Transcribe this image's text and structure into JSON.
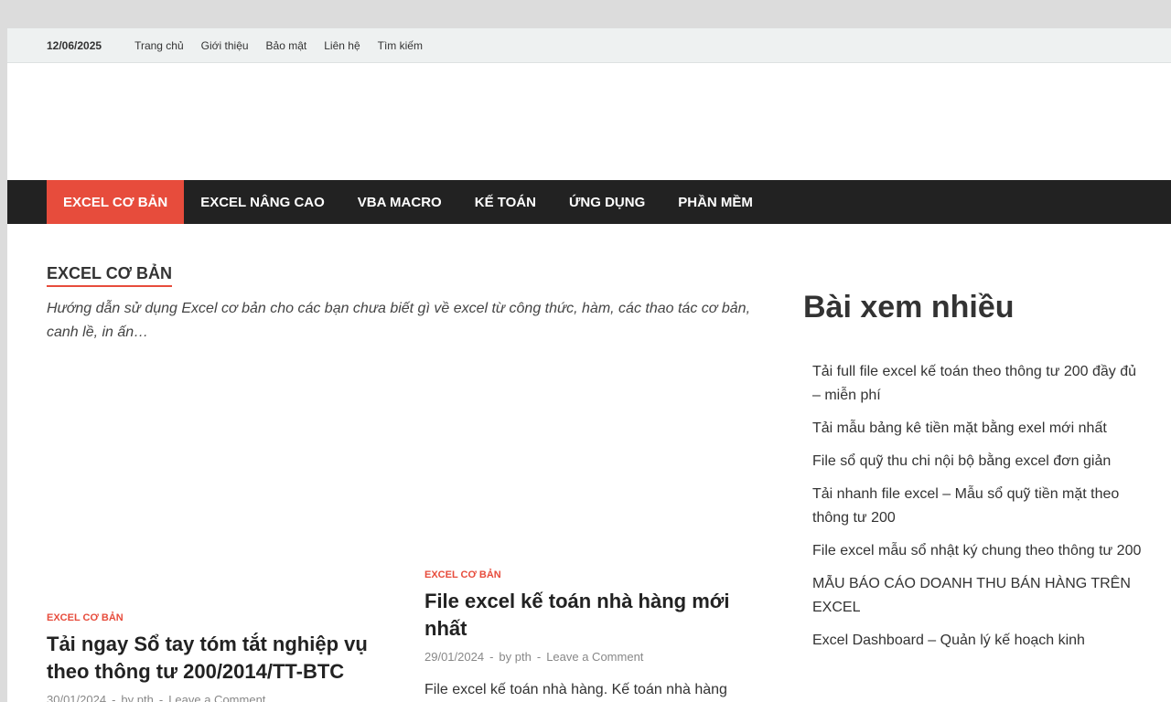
{
  "topbar": {
    "date": "12/06/2025",
    "links": [
      "Trang chủ",
      "Giới thiệu",
      "Bảo mật",
      "Liên hệ",
      "Tìm kiếm"
    ]
  },
  "nav": {
    "items": [
      "EXCEL CƠ BẢN",
      "EXCEL NÂNG CAO",
      "VBA MACRO",
      "KẾ TOÁN",
      "ỨNG DỤNG",
      "PHẦN MỀM"
    ]
  },
  "archive": {
    "title": "EXCEL CƠ BẢN",
    "description": "Hướng dẫn sử dụng Excel cơ bản cho các bạn chưa biết gì về excel từ công thức, hàm, các thao tác cơ bản, canh lề, in ấn…"
  },
  "posts": [
    {
      "category": "EXCEL CƠ BẢN",
      "title": "Tải ngay Sổ tay tóm tắt nghiệp vụ theo thông tư 200/2014/TT-BTC",
      "date": "30/01/2024",
      "author": "by pth",
      "comment": "Leave a Comment"
    },
    {
      "category": "EXCEL CƠ BẢN",
      "title": "File excel kế toán nhà hàng mới nhất",
      "date": "29/01/2024",
      "author": "by pth",
      "comment": "Leave a Comment",
      "excerpt": "File excel kế toán nhà hàng. Kế toán nhà hàng"
    }
  ],
  "meta_separator": "-",
  "sidebar": {
    "title": "Bài xem nhiều",
    "items": [
      "Tải full file excel kế toán theo thông tư 200 đầy đủ – miễn phí",
      "Tải mẫu bảng kê tiền mặt bằng exel mới nhất",
      "File sổ quỹ thu chi nội bộ bằng excel đơn giản",
      "Tải nhanh file excel – Mẫu sổ quỹ tiền mặt theo thông tư 200",
      "File excel mẫu sổ nhật ký chung theo thông tư 200",
      "MẪU BÁO CÁO DOANH THU BÁN HÀNG TRÊN EXCEL",
      "Excel Dashboard – Quản lý kế hoạch kinh"
    ]
  },
  "colors": {
    "accent": "#e74c3c",
    "nav_bg": "#222222",
    "topbar_bg": "#eef1f1"
  }
}
